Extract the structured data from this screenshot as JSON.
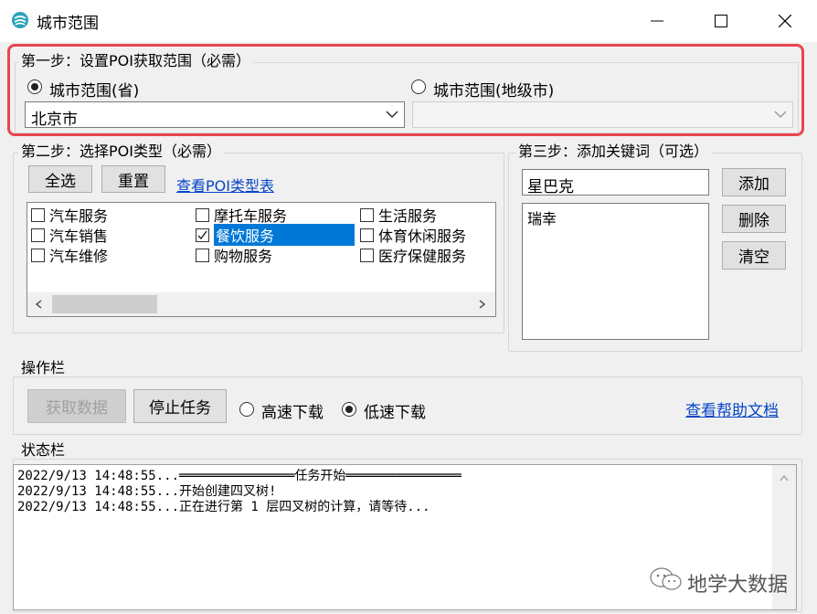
{
  "window": {
    "title": "城市范围"
  },
  "step1": {
    "legend": "第一步：设置POI获取范围（必需）",
    "radio_province": "城市范围(省)",
    "radio_city": "城市范围(地级市)",
    "province_value": "北京市",
    "city_value": "",
    "selected_radio": "province"
  },
  "step2": {
    "legend": "第二步：选择POI类型（必需）",
    "select_all": "全选",
    "reset": "重置",
    "view_types_link": "查看POI类型表",
    "columns": [
      [
        {
          "label": "汽车服务",
          "checked": false
        },
        {
          "label": "汽车销售",
          "checked": false
        },
        {
          "label": "汽车维修",
          "checked": false
        }
      ],
      [
        {
          "label": "摩托车服务",
          "checked": false
        },
        {
          "label": "餐饮服务",
          "checked": true,
          "selected": true
        },
        {
          "label": "购物服务",
          "checked": false
        }
      ],
      [
        {
          "label": "生活服务",
          "checked": false
        },
        {
          "label": "体育休闲服务",
          "checked": false
        },
        {
          "label": "医疗保健服务",
          "checked": false
        }
      ]
    ]
  },
  "step3": {
    "legend": "第三步：添加关键词（可选）",
    "keyword_input": "星巴克",
    "add": "添加",
    "delete": "删除",
    "clear": "清空",
    "keywords": [
      "瑞幸"
    ]
  },
  "ops": {
    "legend": "操作栏",
    "fetch": "获取数据",
    "stop": "停止任务",
    "fast": "高速下载",
    "slow": "低速下载",
    "speed_selected": "slow",
    "help_link": "查看帮助文档"
  },
  "status": {
    "legend": "状态栏",
    "lines": [
      "2022/9/13 14:48:55...═══════════════任务开始═══════════════",
      "2022/9/13 14:48:55...开始创建四叉树!",
      "2022/9/13 14:48:55...正在进行第 1 层四叉树的计算，请等待..."
    ]
  },
  "watermark": "地学大数据",
  "colors": {
    "highlight": "#e8454f",
    "link": "#0645c8",
    "selection": "#0078d7"
  }
}
